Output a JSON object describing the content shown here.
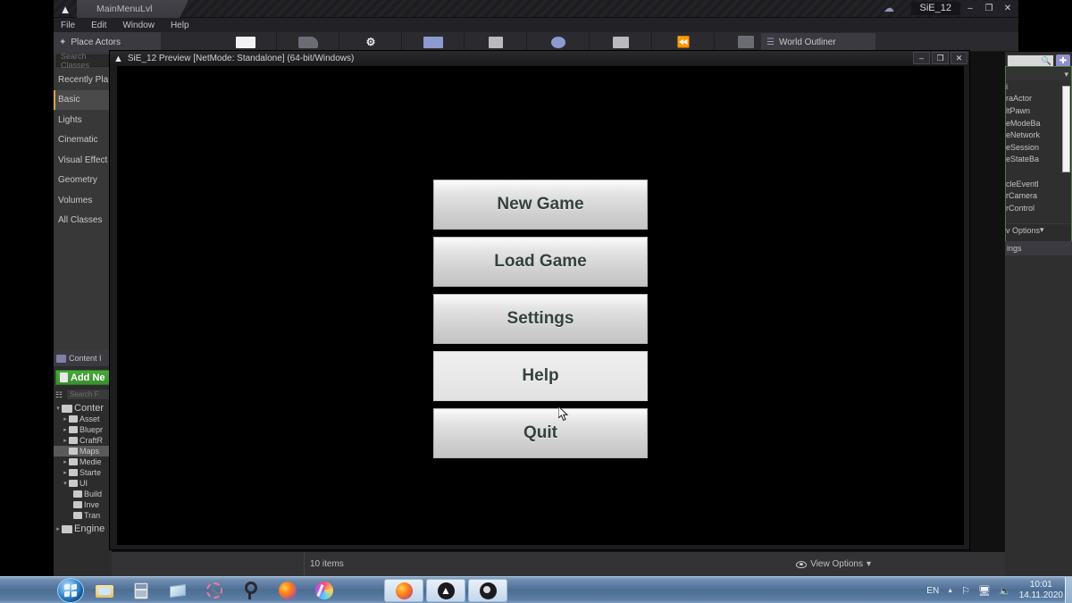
{
  "editor": {
    "logo_icon": "unreal-logo-icon",
    "tab_label": "MainMenuLvl",
    "project_name": "SiE_12",
    "cloud_icon": "cloud-icon",
    "window_controls": [
      {
        "name": "minimize-button",
        "glyph": "–"
      },
      {
        "name": "maximize-button",
        "glyph": "❐"
      },
      {
        "name": "close-button",
        "glyph": "✕"
      }
    ],
    "menus": [
      "File",
      "Edit",
      "Window",
      "Help"
    ],
    "place_actors_tab": "Place Actors",
    "place_actors_icon": "place-actors-icon",
    "world_outliner_tab": "World Outliner",
    "world_outliner_icon": "outliner-icon",
    "toolbar_icons": [
      {
        "name": "save-current-icon",
        "style": "g-white"
      },
      {
        "name": "source-control-icon",
        "style": "g-dark"
      },
      {
        "name": "settings-icon",
        "style": "g-txt",
        "glyph": "⚙"
      },
      {
        "name": "blueprints-icon",
        "style": "g-blue"
      },
      {
        "name": "cinematics-icon",
        "style": "g-grey"
      },
      {
        "name": "build-icon",
        "style": "g-dark"
      },
      {
        "name": "play-icon",
        "style": "g-white"
      },
      {
        "name": "launch-icon",
        "style": "g-grey"
      },
      {
        "name": "folder-icon",
        "style": "g-dark"
      },
      {
        "name": "pause-icon",
        "style": "g-grey"
      }
    ]
  },
  "place_actors": {
    "search_placeholder": "Search Classes",
    "items": [
      {
        "label": "Recently Pla",
        "selected": false
      },
      {
        "label": "Basic",
        "selected": true
      },
      {
        "label": "Lights",
        "selected": false
      },
      {
        "label": "Cinematic",
        "selected": false
      },
      {
        "label": "Visual Effect",
        "selected": false
      },
      {
        "label": "Geometry",
        "selected": false
      },
      {
        "label": "Volumes",
        "selected": false
      },
      {
        "label": "All Classes",
        "selected": false
      }
    ]
  },
  "content_browser": {
    "tab_label": "Content I",
    "add_new_label": "Add Ne",
    "search_placeholder": "Search F",
    "filter_icon": "filter-icon",
    "tree": [
      {
        "label": "Conter",
        "depth": 0,
        "arrow": "▾",
        "selected": false,
        "root": true
      },
      {
        "label": "Asset",
        "depth": 1,
        "arrow": "▸",
        "selected": false
      },
      {
        "label": "Bluepr",
        "depth": 1,
        "arrow": "▸",
        "selected": false
      },
      {
        "label": "CraftR",
        "depth": 1,
        "arrow": "▸",
        "selected": false
      },
      {
        "label": "Maps",
        "depth": 1,
        "arrow": "",
        "selected": true
      },
      {
        "label": "Medie",
        "depth": 1,
        "arrow": "▸",
        "selected": false
      },
      {
        "label": "Starte",
        "depth": 1,
        "arrow": "▸",
        "selected": false
      },
      {
        "label": "UI",
        "depth": 1,
        "arrow": "▾",
        "selected": false
      },
      {
        "label": "Build",
        "depth": 2,
        "arrow": "",
        "selected": false
      },
      {
        "label": "Inve",
        "depth": 2,
        "arrow": "",
        "selected": false
      },
      {
        "label": "Tran",
        "depth": 2,
        "arrow": "",
        "selected": false
      },
      {
        "label": "Engine",
        "depth": 0,
        "arrow": "▸",
        "selected": false,
        "root": true
      }
    ],
    "status_items": "10 items",
    "view_options_label": "View Options",
    "view_options_caret": "▾",
    "view_options_icon": "eye-icon"
  },
  "world_outliner": {
    "search_icon": "search-icon",
    "add_icon": "add-icon",
    "column_caret": "▾",
    "rows": [
      "i",
      "raActor",
      "ltPawn",
      "eModeBa",
      "eNetwork",
      "eSession",
      "eStateBa",
      "",
      "cleEventl",
      "rCamera",
      "rControl"
    ],
    "view_options_label": "v Options",
    "view_options_caret": "▾",
    "settings_label": "ings"
  },
  "preview": {
    "logo_icon": "unreal-logo-icon",
    "title": "SiE_12 Preview [NetMode: Standalone] (64-bit/Windows)",
    "controls": [
      {
        "name": "preview-minimize-button",
        "glyph": "–"
      },
      {
        "name": "preview-maximize-button",
        "glyph": "❐"
      },
      {
        "name": "preview-close-button",
        "glyph": "✕"
      }
    ]
  },
  "game_menu": {
    "buttons": [
      {
        "label": "New Game",
        "state": "normal"
      },
      {
        "label": "Load Game",
        "state": "normal"
      },
      {
        "label": "Settings",
        "state": "normal"
      },
      {
        "label": "Help",
        "state": "hover"
      },
      {
        "label": "Quit",
        "state": "normal"
      }
    ],
    "text_color": "#34423f"
  },
  "taskbar": {
    "start_icon": "windows-start-orb-icon",
    "quick_launch": [
      {
        "name": "file-explorer-icon"
      },
      {
        "name": "calculator-icon"
      },
      {
        "name": "notepad-icon"
      },
      {
        "name": "snipping-tool-icon"
      },
      {
        "name": "photoscape-icon"
      },
      {
        "name": "firefox-icon"
      },
      {
        "name": "paint-icon"
      }
    ],
    "open_windows": [
      {
        "name": "taskbar-firefox-button"
      },
      {
        "name": "taskbar-unreal-engine-button"
      },
      {
        "name": "taskbar-obs-button"
      }
    ],
    "tray": {
      "language": "EN",
      "show_hidden_icons": "▲",
      "flag_icon": "flag-icon",
      "network_icon": "network-icon",
      "volume_icon": "volume-icon",
      "time": "10:01",
      "date": "14.11.2020"
    }
  }
}
